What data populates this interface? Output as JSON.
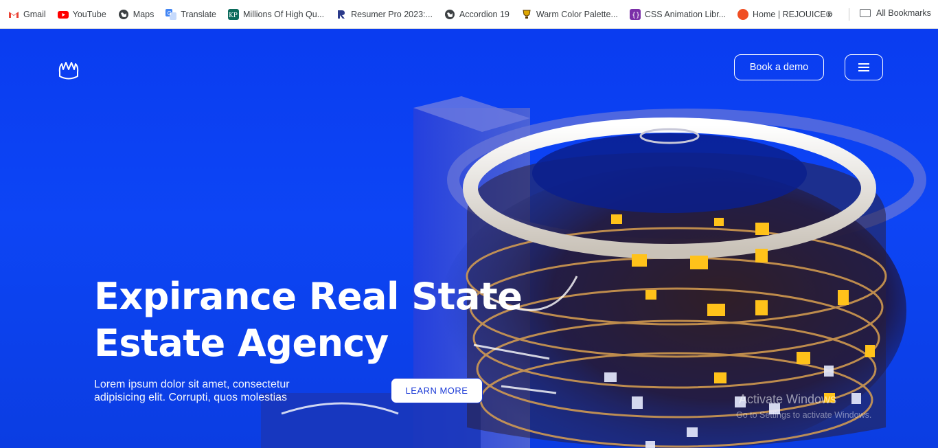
{
  "bookmarks": {
    "items": [
      {
        "label": "Gmail",
        "icon": "gmail-icon",
        "color": "#ea4335"
      },
      {
        "label": "YouTube",
        "icon": "youtube-icon",
        "color": "#ff0000"
      },
      {
        "label": "Maps",
        "icon": "globe-icon",
        "color": "#3c4043"
      },
      {
        "label": "Translate",
        "icon": "translate-icon",
        "color": "#4285f4"
      },
      {
        "label": "Millions Of High Qu...",
        "icon": "kp-icon",
        "color": "#0b6b5c"
      },
      {
        "label": "Resumer Pro 2023:...",
        "icon": "resumer-icon",
        "color": "#2b3a8a"
      },
      {
        "label": "Accordion 19",
        "icon": "globe-icon",
        "color": "#3c4043"
      },
      {
        "label": "Warm Color Palette...",
        "icon": "trophy-icon",
        "color": "#b8860b"
      },
      {
        "label": "CSS Animation Libr...",
        "icon": "code-icon",
        "color": "#7b2fa8"
      },
      {
        "label": "Home | REJOUICE®",
        "icon": "rejouice-icon",
        "color": "#f04e23"
      }
    ],
    "more": "»",
    "all_label": "All Bookmarks"
  },
  "header": {
    "logo": "crown-logo-icon",
    "demo_label": "Book a demo",
    "menu_icon": "hamburger-icon"
  },
  "hero": {
    "title_line1": "Expirance Real State",
    "title_line2": "Estate Agency",
    "subtitle": "Lorem ipsum dolor sit amet, consectetur adipisicing elit. Corrupti, quos molestias",
    "cta_label": "LEARN MORE",
    "image": "glass-building-render"
  },
  "os_watermark": {
    "line1": "Activate Windows",
    "line2": "Go to Settings to activate Windows."
  },
  "colors": {
    "brand_blue": "#0b3ee8",
    "cta_text": "#1b3ad6"
  }
}
